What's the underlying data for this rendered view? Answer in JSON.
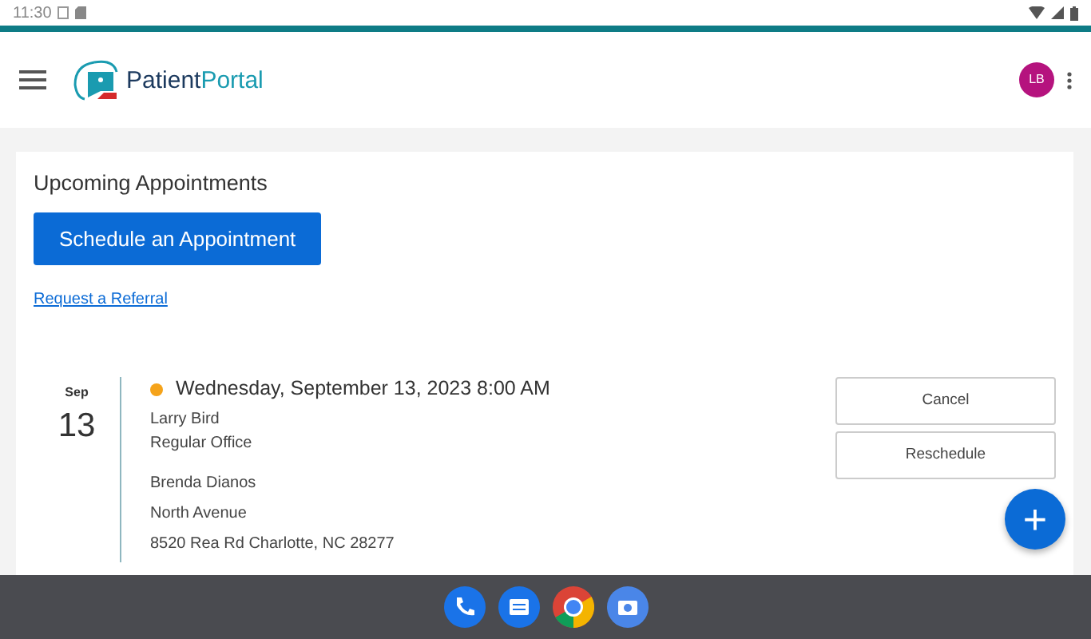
{
  "status_bar": {
    "time": "11:30"
  },
  "app_bar": {
    "logo_text_1": "Patient",
    "logo_text_2": "Portal",
    "avatar": "LB"
  },
  "page": {
    "title": "Upcoming Appointments",
    "primary_button": "Schedule an Appointment",
    "link": "Request a Referral"
  },
  "appointments": [
    {
      "month": "Sep",
      "day": "13",
      "color": "#f5a31a",
      "datetime": "Wednesday, September 13, 2023 8:00 AM",
      "lines_1": [
        "Larry Bird",
        "Regular Office"
      ],
      "lines_2": [
        "Brenda Dianos",
        "North Avenue",
        "8520 Rea Rd Charlotte, NC 28277"
      ],
      "actions": [
        "Cancel",
        "Reschedule"
      ]
    }
  ],
  "fab": "+"
}
